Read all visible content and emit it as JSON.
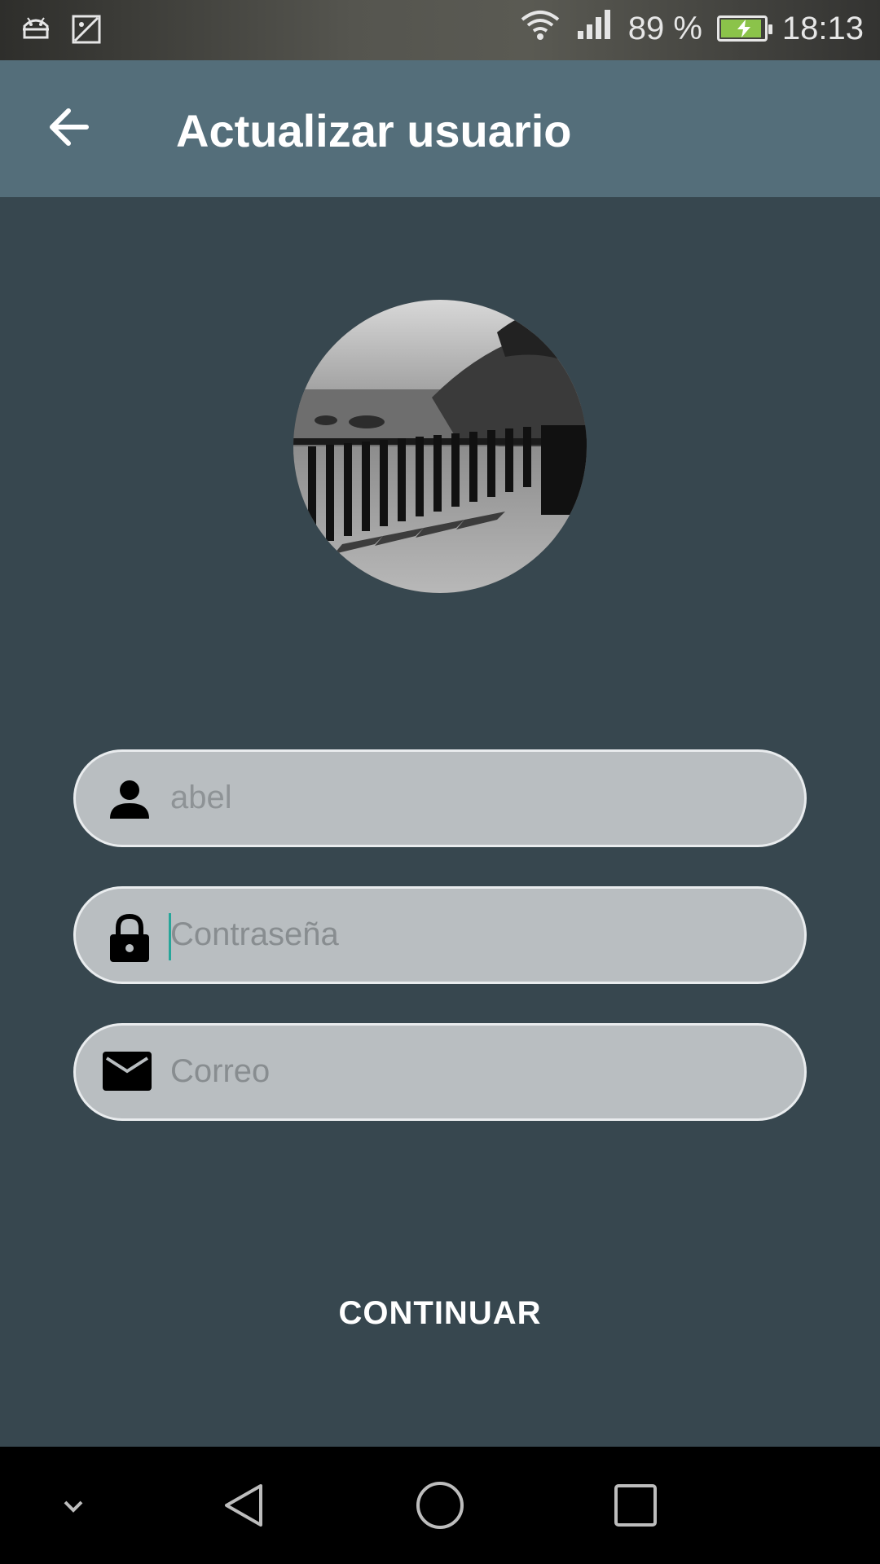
{
  "status_bar": {
    "battery_percent": "89 %",
    "time": "18:13",
    "battery_color": "#8bc34a",
    "icons": [
      "android-debug-icon",
      "image-notification-icon",
      "wifi-icon",
      "signal-icon",
      "battery-charging-icon"
    ]
  },
  "app_bar": {
    "title": "Actualizar usuario",
    "background": "#546e7a"
  },
  "form": {
    "username": {
      "value": "abel",
      "icon": "person-icon"
    },
    "password": {
      "placeholder": "Contraseña",
      "icon": "lock-icon",
      "focused": true
    },
    "email": {
      "placeholder": "Correo",
      "icon": "mail-icon"
    }
  },
  "actions": {
    "continue_label": "CONTINUAR"
  },
  "nav_bar": {
    "items": [
      "collapse-icon",
      "back-triangle-icon",
      "home-circle-icon",
      "recents-square-icon"
    ]
  },
  "colors": {
    "background": "#37474f",
    "field": "#b9bec1",
    "caret": "#26a69a"
  }
}
